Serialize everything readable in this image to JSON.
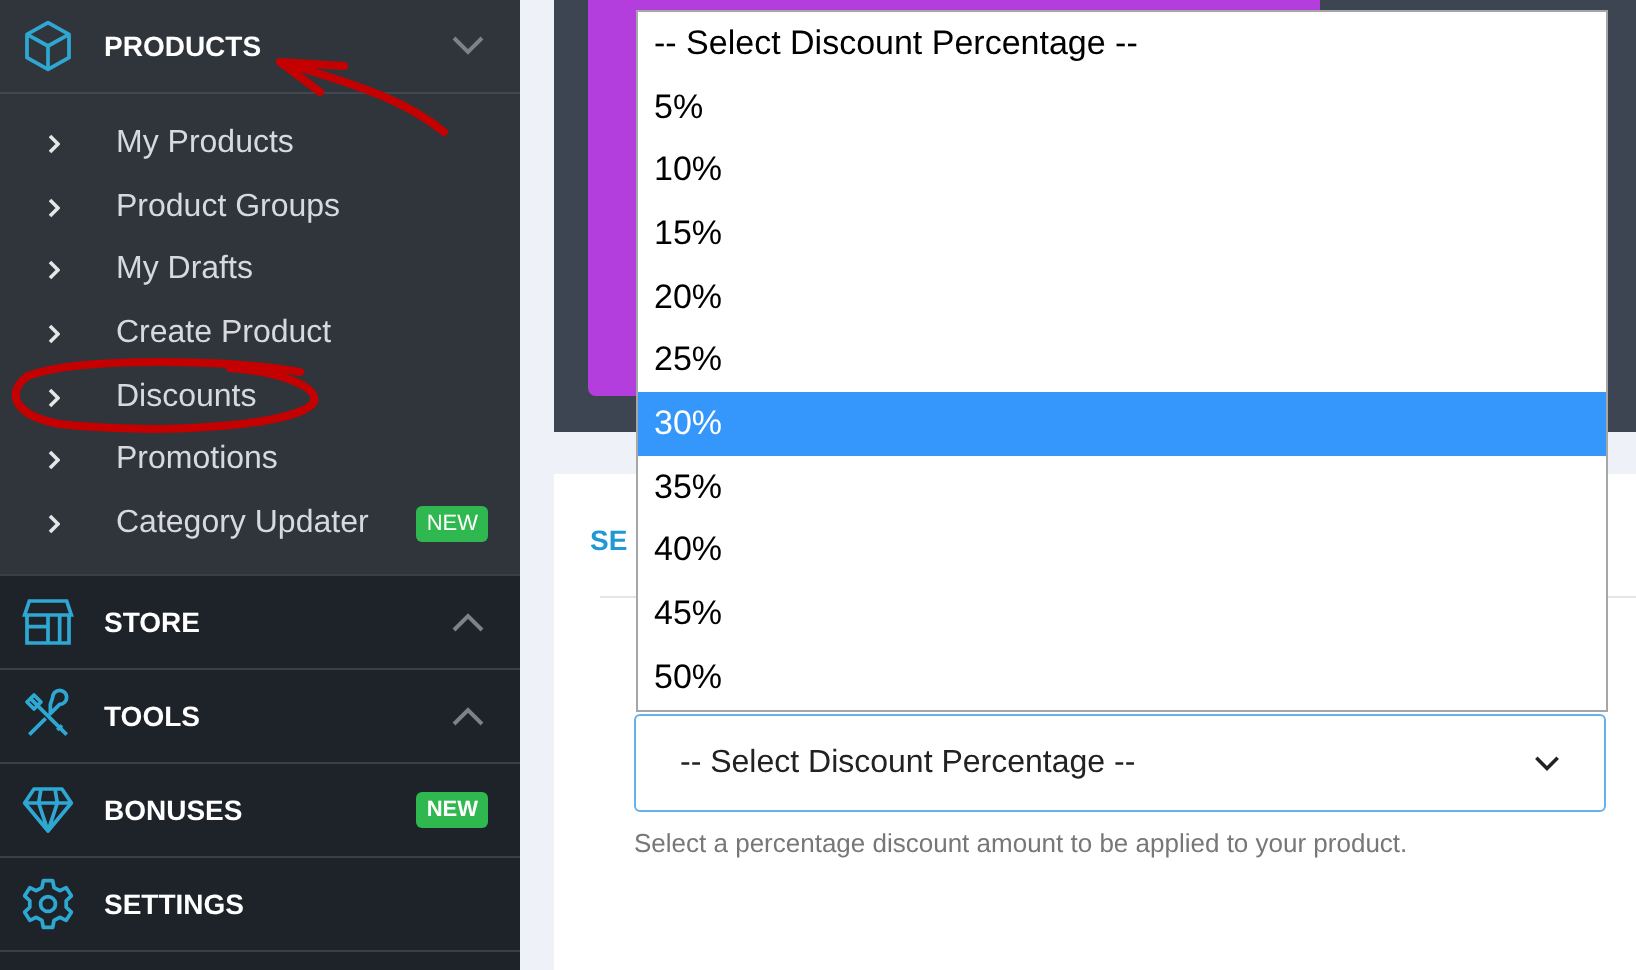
{
  "sidebar": {
    "sections": [
      {
        "label": "PRODUCTS",
        "expanded": true,
        "children": [
          {
            "label": "My Products"
          },
          {
            "label": "Product Groups"
          },
          {
            "label": "My Drafts"
          },
          {
            "label": "Create Product"
          },
          {
            "label": "Discounts"
          },
          {
            "label": "Promotions"
          },
          {
            "label": "Category Updater",
            "badge": "NEW"
          }
        ]
      },
      {
        "label": "STORE",
        "expanded": false
      },
      {
        "label": "TOOLS",
        "expanded": false
      },
      {
        "label": "BONUSES",
        "badge": "NEW"
      },
      {
        "label": "SETTINGS"
      }
    ]
  },
  "main": {
    "section_heading": "SE",
    "select": {
      "value": "-- Select Discount Percentage --",
      "help": "Select a percentage discount amount to be applied to your product."
    },
    "dropdown": {
      "options": [
        {
          "label": "-- Select Discount Percentage --",
          "selected": false
        },
        {
          "label": "5%",
          "selected": false
        },
        {
          "label": "10%",
          "selected": false
        },
        {
          "label": "15%",
          "selected": false
        },
        {
          "label": "20%",
          "selected": false
        },
        {
          "label": "25%",
          "selected": false
        },
        {
          "label": "30%",
          "selected": true
        },
        {
          "label": "35%",
          "selected": false
        },
        {
          "label": "40%",
          "selected": false
        },
        {
          "label": "45%",
          "selected": false
        },
        {
          "label": "50%",
          "selected": false
        }
      ]
    }
  }
}
